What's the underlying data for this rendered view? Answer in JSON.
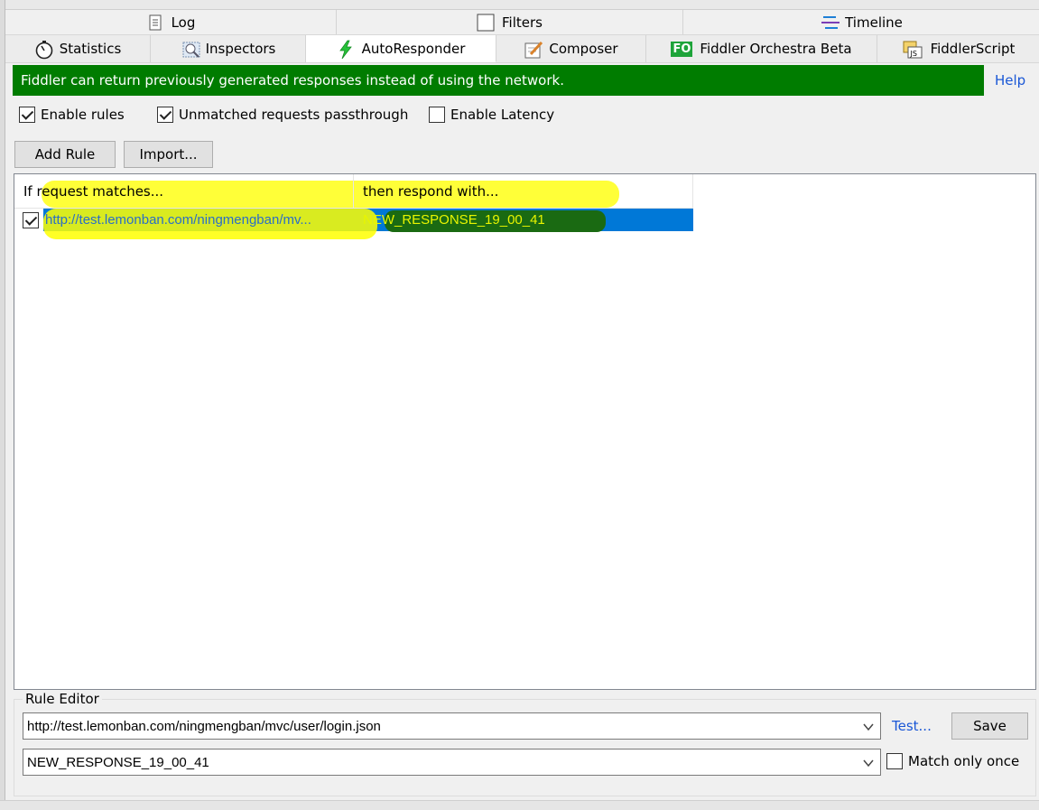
{
  "tabs_top": [
    {
      "label": "Log",
      "icon": "log-icon"
    },
    {
      "label": "Filters",
      "icon": "filters-checkbox-icon"
    },
    {
      "label": "Timeline",
      "icon": "timeline-icon"
    }
  ],
  "tabs_main": [
    {
      "label": "Statistics",
      "icon": "stopwatch-icon"
    },
    {
      "label": "Inspectors",
      "icon": "inspectors-icon"
    },
    {
      "label": "AutoResponder",
      "icon": "lightning-icon",
      "active": true
    },
    {
      "label": "Composer",
      "icon": "composer-icon"
    },
    {
      "label": "Fiddler Orchestra Beta",
      "icon": "fo-badge-icon",
      "badge": "FO"
    },
    {
      "label": "FiddlerScript",
      "icon": "fiddlerscript-icon",
      "badge": "JS"
    }
  ],
  "banner": {
    "text": "Fiddler can return previously generated responses instead of using the network.",
    "color": "#007c00"
  },
  "help": "Help",
  "options": {
    "enable_rules": {
      "label": "Enable rules",
      "checked": true
    },
    "passthrough": {
      "label": "Unmatched requests passthrough",
      "checked": true
    },
    "latency": {
      "label": "Enable Latency",
      "checked": false
    }
  },
  "buttons": {
    "add_rule": "Add Rule",
    "import": "Import..."
  },
  "list": {
    "columns": [
      "If request matches...",
      "then respond with..."
    ],
    "rows": [
      {
        "checked": true,
        "match": "http://test.lemonban.com/ningmengban/mv...",
        "response": "NEW_RESPONSE_19_00_41",
        "selected": true
      }
    ]
  },
  "editor": {
    "legend": "Rule Editor",
    "match_value": "http://test.lemonban.com/ningmengban/mvc/user/login.json",
    "response_value": "NEW_RESPONSE_19_00_41",
    "test_link": "Test...",
    "save_button": "Save",
    "match_once": {
      "label": "Match only once",
      "checked": false
    }
  },
  "colors": {
    "selection": "#0078d7",
    "highlight": "#ffff00",
    "link": "#1a57d6"
  }
}
